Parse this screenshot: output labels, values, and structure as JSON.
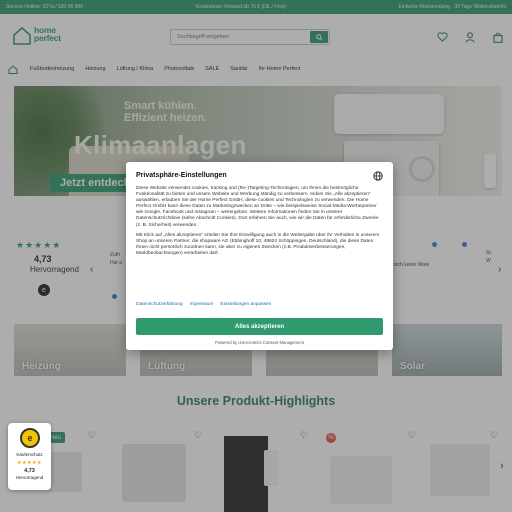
{
  "topbar": {
    "hotline": "Service-Hotline: 02?a / 520 06 996",
    "shipping": "Kostenloser Versand ab 75 € (DE / Fest)",
    "returns": "Einfache Rücksendung · 30 Tage Widerrufsrecht"
  },
  "header": {
    "logo_line1": "home",
    "logo_line2": "perfect",
    "search_placeholder": "Suchbegriff eingeben",
    "icons": [
      "search-icon",
      "heart-icon",
      "user-icon",
      "cart-icon"
    ]
  },
  "nav": {
    "items": [
      "Fußbodenheizung",
      "Heizung",
      "Lüftung / Klima",
      "Photovoltaik",
      "SALE",
      "Sanitär",
      "Ihr Home Perfect"
    ]
  },
  "hero": {
    "tagline_1": "Smart kühlen.",
    "tagline_2": "Effizient heizen.",
    "title": "Klimaanlagen",
    "cta": "Jetzt entdecken"
  },
  "ratings": {
    "score": "4,73",
    "label": "Hervorragend",
    "review_1_a": "Zufri",
    "review_1_b": "Hat a",
    "review_2": "noch keine Ware",
    "review_3_a": "Sc",
    "review_3_b": "W"
  },
  "categories": [
    "Heizung",
    "Lüftung",
    "",
    "Solar"
  ],
  "highlights": {
    "title": "Unsere Produkt-Highlights",
    "badge": "Neu",
    "sale_badge": "%"
  },
  "trust": {
    "seal": "e",
    "label": "Käuferschutz",
    "stars": "★★★★★",
    "score": "4,73",
    "rating": "Hervorragend"
  },
  "consent": {
    "title": "Privatsphäre-Einstellungen",
    "paragraph_1": "Diese Website verwendet cookies, tracking und (Re-)Targeting-Technologien, um Ihnen die bestmögliche Funktionalität zu bieten und unsere Website und Werbung ständig zu verbessern. Indem Sie „Alle akzeptieren“ auswählen, erlauben Sie der Home Perfect GmbH, diese cookies und Technologien zu verwenden. Die Home Perfect GmbH kann diese Daten zu Marketingzwecken an Dritte – wie beispielsweise Social-Media-Werbepartner wie Google, Facebook und Instagram – weitergeben. Weitere Informationen finden Sie in unserer Datenschutzrichtlinie (siehe Abschnitt Cookies). Dort erfahren Sie auch, wie wir die Daten für erforderliche Zwecke (z. B. Sicherheit) verwenden.",
    "paragraph_2": "Mit Klick auf „Alles akzeptieren“ erteilen Sie Ihre Einwilligung auch in die Weitergabe über Ihr Verhalten in unserem Shop an unseren Partner, die shopware AG (Ebbinghoff 10, 48624 Schöppingen, Deutschland), die diese Daten Ihnen nicht persönlich zuordnen kann, sie aber zu eigenen Zwecken (z.B. Produktverbesserungen, Marktbeobachtungen) verarbeiten darf.",
    "link_privacy": "Datenschutzerklärung",
    "link_imprint": "Impressum",
    "link_settings": "Einstellungen anpassen",
    "accept": "Alles akzeptieren",
    "footer": "Powered by Usercentrics Consent Management"
  },
  "colors": {
    "brand": "#2e9a6e",
    "link": "#2b6cb0"
  }
}
